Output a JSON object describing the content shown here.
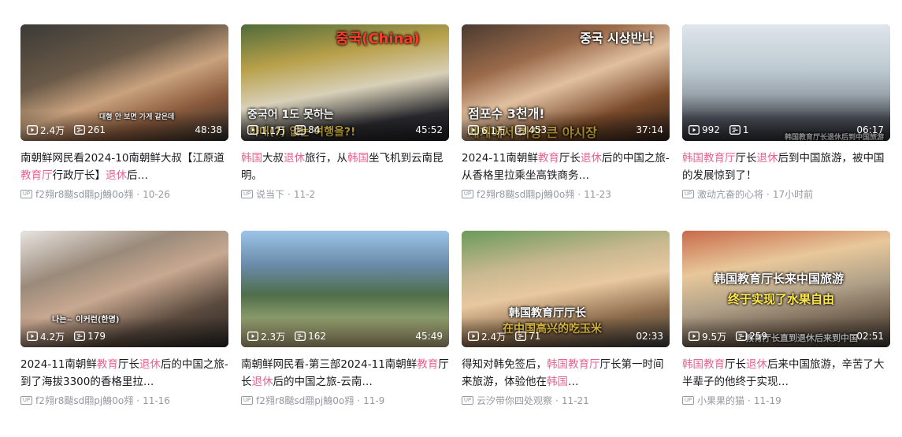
{
  "videos": [
    {
      "overlay": [
        "",
        "대형 안 보면 가게 같은데"
      ],
      "views": "2.4万",
      "danmaku": "261",
      "duration": "48:38",
      "title_parts": [
        {
          "t": "南朝鲜网民看2024-10南朝鲜大叔【江原道"
        },
        {
          "t": "教育厅",
          "kw": true
        },
        {
          "t": "行政厅长】"
        },
        {
          "t": "退休",
          "kw": true
        },
        {
          "t": "后…"
        }
      ],
      "author": "f2翙r8颰sd翢pj鯓0o翙",
      "date": "10-26"
    },
    {
      "overlay": [
        "중국(China)",
        "중국어 1도 못하는",
        "아내(?) 없는 여행을?!"
      ],
      "views": "1.1万",
      "danmaku": "84",
      "duration": "45:52",
      "title_parts": [
        {
          "t": "韩国",
          "kw": true
        },
        {
          "t": "大叔"
        },
        {
          "t": "退休",
          "kw": true
        },
        {
          "t": "旅行，从"
        },
        {
          "t": "韩国",
          "kw": true
        },
        {
          "t": "坐飞机到云南昆明。"
        }
      ],
      "author": "说当下",
      "date": "11-2"
    },
    {
      "overlay": [
        "중국 시상반나",
        "점포수 3천개!",
        "세계에서 가장 큰 야시장"
      ],
      "views": "6.1万",
      "danmaku": "453",
      "duration": "37:14",
      "title_parts": [
        {
          "t": "2024-11南朝鲜"
        },
        {
          "t": "教育",
          "kw": true
        },
        {
          "t": "厅长"
        },
        {
          "t": "退休",
          "kw": true
        },
        {
          "t": "后的中国之旅-从香格里拉乘坐高铁商务…"
        }
      ],
      "author": "f2翙r8颰sd翢pj鯓0o翙",
      "date": "11-23"
    },
    {
      "overlay": [
        "韩国教育厅长退休后到中国旅游"
      ],
      "views": "992",
      "danmaku": "1",
      "duration": "06:17",
      "title_parts": [
        {
          "t": "韩国教育厅",
          "kw": true
        },
        {
          "t": "厅长"
        },
        {
          "t": "退休",
          "kw": true
        },
        {
          "t": "后到中国旅游，被中国的发展惊到了！"
        }
      ],
      "author": "激动亢奋的心将",
      "date": "17小时前"
    },
    {
      "overlay": [
        "나는~ 이커런(한명)"
      ],
      "views": "4.2万",
      "danmaku": "179",
      "duration": "",
      "title_parts": [
        {
          "t": "2024-11南朝鲜"
        },
        {
          "t": "教育",
          "kw": true
        },
        {
          "t": "厅长"
        },
        {
          "t": "退休",
          "kw": true
        },
        {
          "t": "后的中国之旅-到了海拔3300的香格里拉…"
        }
      ],
      "author": "f2翙r8颰sd翢pj鯓0o翙",
      "date": "11-16"
    },
    {
      "overlay": [],
      "views": "2.3万",
      "danmaku": "162",
      "duration": "45:49",
      "title_parts": [
        {
          "t": "南朝鲜网民看-第三部2024-11南朝鲜"
        },
        {
          "t": "教育",
          "kw": true
        },
        {
          "t": "厅长"
        },
        {
          "t": "退休",
          "kw": true
        },
        {
          "t": "后的中国之旅-云南…"
        }
      ],
      "author": "f2翙r8颰sd翢pj鯓0o翙",
      "date": "11-9"
    },
    {
      "overlay": [
        "韩国教育厅厅长",
        "在中国高兴的吃玉米"
      ],
      "views": "2.4万",
      "danmaku": "71",
      "duration": "02:33",
      "title_parts": [
        {
          "t": "得知对韩免签后，"
        },
        {
          "t": "韩国教育厅",
          "kw": true
        },
        {
          "t": "厅长第一时间来旅游，体验他在"
        },
        {
          "t": "韩国",
          "kw": true
        },
        {
          "t": "…"
        }
      ],
      "author": "云汐带你四处观察",
      "date": "11-21"
    },
    {
      "overlay": [
        "韩国教育厅长来中国旅游",
        "终于实现了水果自由",
        "教育厅长直到退休后来到中国"
      ],
      "views": "9.5万",
      "danmaku": "259",
      "duration": "02:51",
      "title_parts": [
        {
          "t": "韩国教育",
          "kw": true
        },
        {
          "t": "厅长"
        },
        {
          "t": "退休",
          "kw": true
        },
        {
          "t": "后来中国旅游，辛苦了大半辈子的他终于实现…"
        }
      ],
      "author": "小果果的猫",
      "date": "11-19"
    }
  ],
  "up_badge": "UP",
  "icons": {
    "views": "play-count-icon",
    "danmaku": "danmaku-icon",
    "up": "up-badge-icon"
  },
  "colors": {
    "keyword": "#e8638f",
    "meta": "#9499a0",
    "title": "#18191c"
  }
}
